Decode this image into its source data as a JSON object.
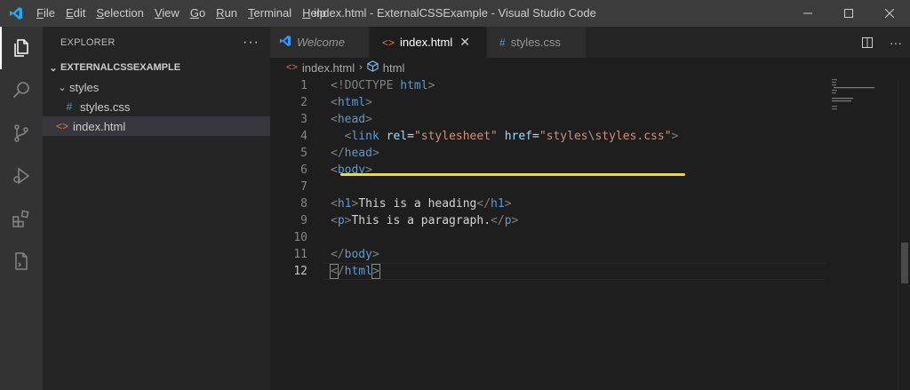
{
  "titlebar": {
    "logo_icon": "vscode-logo",
    "menu": [
      "File",
      "Edit",
      "Selection",
      "View",
      "Go",
      "Run",
      "Terminal",
      "Help"
    ],
    "menu_mnemonic": [
      "F",
      "E",
      "S",
      "V",
      "G",
      "R",
      "T",
      "H"
    ],
    "title": "index.html - ExternalCSSExample - Visual Studio Code"
  },
  "activitybar": {
    "items": [
      "explorer-icon",
      "search-icon",
      "source-control-icon",
      "run-debug-icon",
      "extensions-icon",
      "remote-file-icon"
    ]
  },
  "sidebar": {
    "header": "EXPLORER",
    "more": "···",
    "section": "EXTERNALCSSEXAMPLE",
    "folder": "styles",
    "css_file": "styles.css",
    "css_icon": "#",
    "html_file": "index.html",
    "html_icon": "<>"
  },
  "tabs": [
    {
      "label": "Welcome",
      "icon": "vscode-logo"
    },
    {
      "label": "index.html",
      "icon": "<>",
      "close": "✕"
    },
    {
      "label": "styles.css",
      "icon": "#"
    }
  ],
  "breadcrumb": {
    "file": "index.html",
    "element": "html"
  },
  "editor": {
    "line_numbers": [
      "1",
      "2",
      "3",
      "4",
      "5",
      "6",
      "7",
      "8",
      "9",
      "10",
      "11",
      "12"
    ],
    "current_line": "12",
    "lines": [
      [
        [
          "<!DOCTYPE ",
          "punc"
        ],
        [
          "html",
          "tag"
        ],
        [
          ">",
          "punc"
        ]
      ],
      [
        [
          "<",
          "punc"
        ],
        [
          "html",
          "tag"
        ],
        [
          ">",
          "punc"
        ]
      ],
      [
        [
          "<",
          "punc"
        ],
        [
          "head",
          "tag"
        ],
        [
          ">",
          "punc"
        ]
      ],
      [
        [
          "  <",
          "punc"
        ],
        [
          "link",
          "tag"
        ],
        [
          " ",
          "text"
        ],
        [
          "rel",
          "attr"
        ],
        [
          "=",
          "text"
        ],
        [
          "\"stylesheet\"",
          "str"
        ],
        [
          " ",
          "text"
        ],
        [
          "href",
          "attr"
        ],
        [
          "=",
          "text"
        ],
        [
          "\"styles\\styles.css\"",
          "str"
        ],
        [
          ">",
          "punc"
        ]
      ],
      [
        [
          "</",
          "punc"
        ],
        [
          "head",
          "tag"
        ],
        [
          ">",
          "punc"
        ]
      ],
      [
        [
          "<",
          "punc"
        ],
        [
          "body",
          "tag"
        ],
        [
          ">",
          "punc"
        ]
      ],
      [],
      [
        [
          "<",
          "punc"
        ],
        [
          "h1",
          "tag"
        ],
        [
          ">",
          "punc"
        ],
        [
          "This is a heading",
          "text"
        ],
        [
          "</",
          "punc"
        ],
        [
          "h1",
          "tag"
        ],
        [
          ">",
          "punc"
        ]
      ],
      [
        [
          "<",
          "punc"
        ],
        [
          "p",
          "tag"
        ],
        [
          ">",
          "punc"
        ],
        [
          "This is a paragraph.",
          "text"
        ],
        [
          "</",
          "punc"
        ],
        [
          "p",
          "tag"
        ],
        [
          ">",
          "punc"
        ]
      ],
      [],
      [
        [
          "</",
          "punc"
        ],
        [
          "body",
          "tag"
        ],
        [
          ">",
          "punc"
        ]
      ],
      [
        [
          "<",
          "brk"
        ],
        [
          "/",
          "punc"
        ],
        [
          "html",
          "tag"
        ],
        [
          ">",
          "brk"
        ]
      ]
    ]
  },
  "colors": {
    "annotation": "#f5e100",
    "activity_bar": "#333333",
    "sidebar": "#252526",
    "editor": "#1e1e1e",
    "titlebar": "#3c3c3c"
  }
}
